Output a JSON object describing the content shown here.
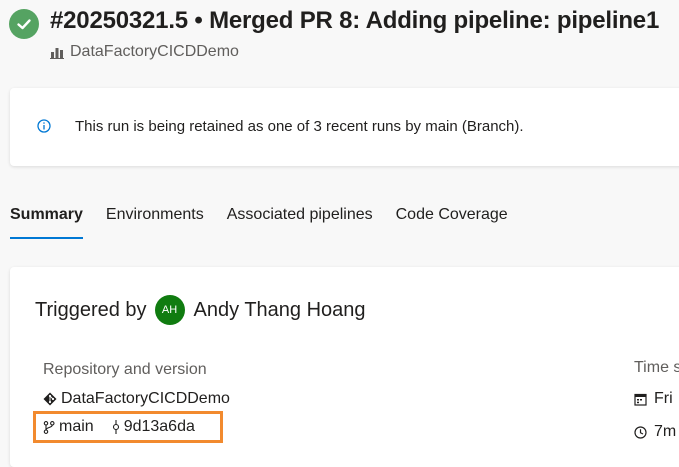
{
  "header": {
    "run_title": "#20250321.5 • Merged PR 8: Adding pipeline: pipeline1",
    "project_name": "DataFactoryCICDDemo",
    "status_icon": "check-icon",
    "status_color": "#55a362"
  },
  "banner": {
    "message": "This run is being retained as one of 3 recent runs by main (Branch).",
    "icon": "info-icon"
  },
  "tabs": [
    {
      "label": "Summary",
      "active": true
    },
    {
      "label": "Environments",
      "active": false
    },
    {
      "label": "Associated pipelines",
      "active": false
    },
    {
      "label": "Code Coverage",
      "active": false
    }
  ],
  "summary": {
    "triggered_by_label": "Triggered by",
    "user_initials": "AH",
    "user_name": "Andy Thang Hoang",
    "repo_heading": "Repository and version",
    "repo_name": "DataFactoryCICDDemo",
    "branch": "main",
    "commit": "9d13a6da",
    "time_heading": "Time s",
    "date_value": "Fri",
    "duration_value": "7m"
  },
  "colors": {
    "accent": "#0078d4",
    "highlight_box": "#f28a2e",
    "avatar": "#107c10"
  }
}
